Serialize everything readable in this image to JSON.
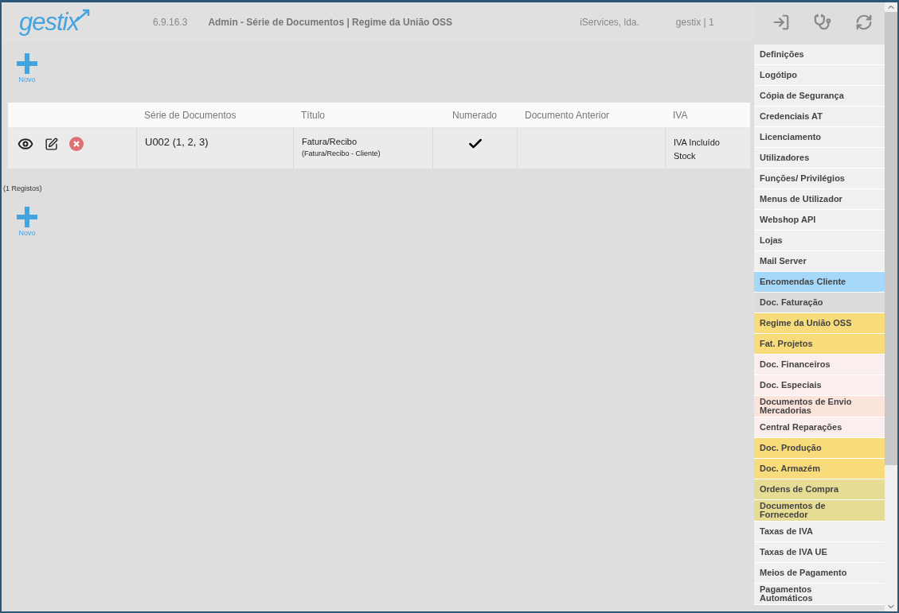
{
  "header": {
    "logo": "gestix",
    "version": "6.9.16.3",
    "title": "Admin - Série de Documentos | Regime da União OSS",
    "company": "iServices, lda.",
    "user": "gestix | 1"
  },
  "new_button_top": {
    "label": "Novo"
  },
  "table": {
    "columns": [
      "",
      "Série de Documentos",
      "Título",
      "Numerado",
      "Documento Anterior",
      "IVA"
    ],
    "rows": [
      {
        "series": "U002 (1, 2, 3)",
        "title": "Fatura/Recibo",
        "subtitle": "(Fatura/Recibo - Cliente)",
        "numbered": true,
        "previous": "",
        "vat": [
          "IVA Incluído",
          "Stock"
        ]
      }
    ]
  },
  "record_count": "(1 Registos)",
  "new_button_bottom": {
    "label": "Novo"
  },
  "menu": [
    {
      "label": "Definições",
      "color": "#f0f0f0"
    },
    {
      "label": "Logótipo",
      "color": "#f0f0f0"
    },
    {
      "label": "Cópia de Segurança",
      "color": "#f0f0f0"
    },
    {
      "label": "Credenciais AT",
      "color": "#f0f0f0"
    },
    {
      "label": "Licenciamento",
      "color": "#f0f0f0"
    },
    {
      "label": "Utilizadores",
      "color": "#f0f0f0"
    },
    {
      "label": "Funções/ Privilégios",
      "color": "#f0f0f0"
    },
    {
      "label": "Menus de Utilizador",
      "color": "#f0f0f0"
    },
    {
      "label": "Webshop API",
      "color": "#f0f0f0"
    },
    {
      "label": "Lojas",
      "color": "#f0f0f0"
    },
    {
      "label": "Mail Server",
      "color": "#f0f0f0"
    },
    {
      "label": "Encomendas Cliente",
      "color": "#a6d8fa"
    },
    {
      "label": "Doc. Faturação",
      "color": "#dcdcdc"
    },
    {
      "label": "Regime da União OSS",
      "color": "#f8dc7c"
    },
    {
      "label": "Fat. Projetos",
      "color": "#f8dc7c"
    },
    {
      "label": "Doc. Financeiros",
      "color": "#faeeee"
    },
    {
      "label": "Doc. Especiais",
      "color": "#faeeee"
    },
    {
      "label": "Documentos de Envio Mercadorias",
      "color": "#fae4dc"
    },
    {
      "label": "Central Reparações",
      "color": "#faeeee"
    },
    {
      "label": "Doc. Produção",
      "color": "#f8dc7c"
    },
    {
      "label": "Doc. Armazém",
      "color": "#f8dc7c"
    },
    {
      "label": "Ordens de Compra",
      "color": "#e6dc94"
    },
    {
      "label": "Documentos de Fornecedor",
      "color": "#e6dc94"
    },
    {
      "label": "Taxas de IVA",
      "color": "#f0f0f0"
    },
    {
      "label": "Taxas de IVA UE",
      "color": "#f0f0f0"
    },
    {
      "label": "Meios de Pagamento",
      "color": "#f0f0f0"
    },
    {
      "label": "Pagamentos Automáticos",
      "color": "#f0f0f0"
    }
  ]
}
